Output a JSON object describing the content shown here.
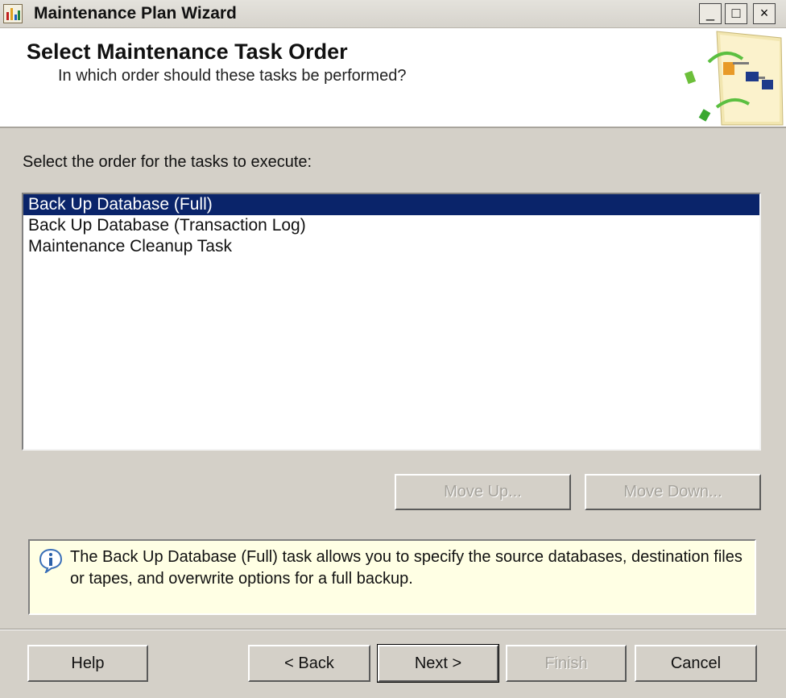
{
  "window": {
    "title": "Maintenance Plan Wizard",
    "minimize_glyph": "_",
    "maximize_glyph": "□",
    "close_glyph": "×"
  },
  "header": {
    "title": "Select Maintenance Task Order",
    "subtitle": "In which order should these tasks be performed?"
  },
  "prompt": "Select the order for the tasks to execute:",
  "tasks": [
    {
      "label": "Back Up Database (Full)",
      "selected": true
    },
    {
      "label": "Back Up Database (Transaction Log)",
      "selected": false
    },
    {
      "label": "Maintenance Cleanup Task",
      "selected": false
    }
  ],
  "order_buttons": {
    "move_up": "Move Up...",
    "move_down": "Move Down..."
  },
  "info": {
    "icon": "info-icon",
    "text": "The Back Up Database (Full) task allows you to specify the source databases, destination files or tapes, and overwrite options for a full backup."
  },
  "footer": {
    "help": "Help",
    "back": "< Back",
    "next": "Next >",
    "finish": "Finish",
    "cancel": "Cancel"
  },
  "colors": {
    "selection": "#0a246a",
    "info_background": "#ffffe4",
    "dialog_background": "#d4d0c8"
  }
}
